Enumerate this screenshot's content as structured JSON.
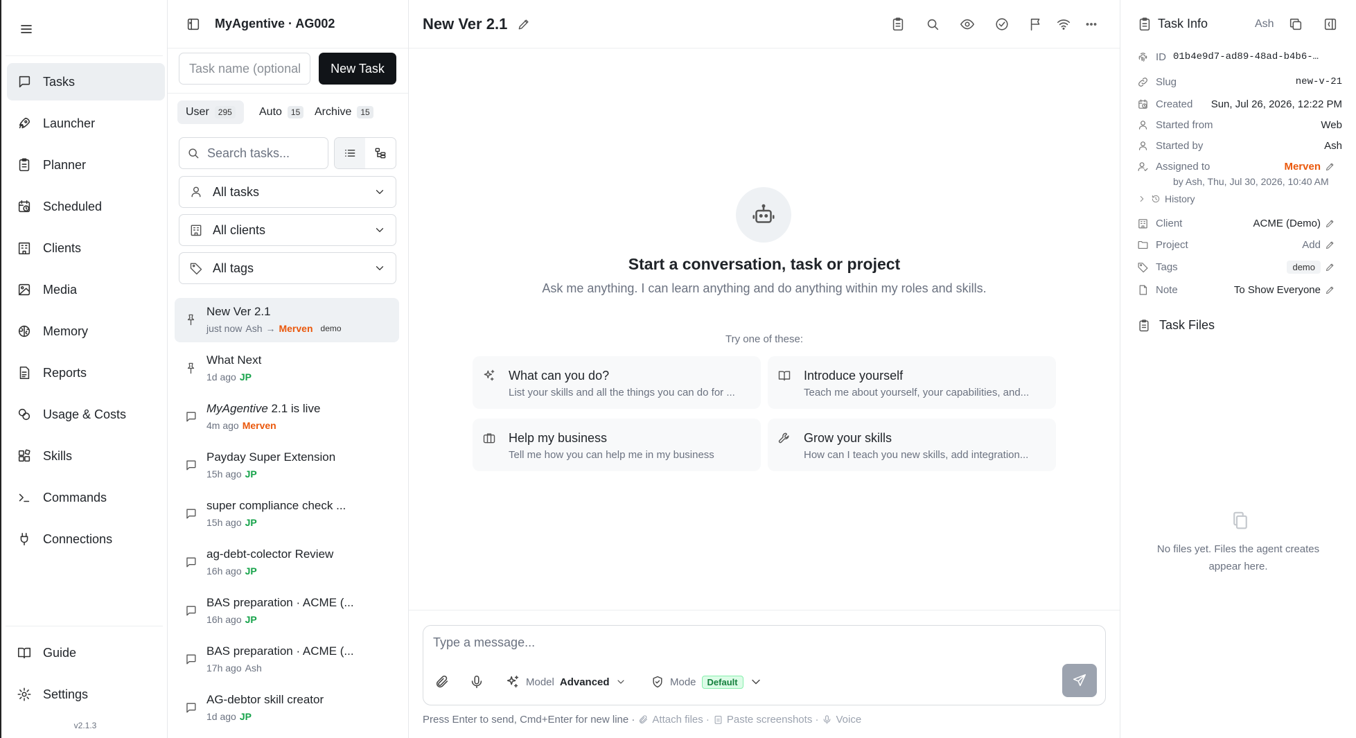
{
  "app": {
    "version": "v2.1.3"
  },
  "nav": {
    "items": [
      {
        "label": "Tasks",
        "icon": "chat-square-icon"
      },
      {
        "label": "Launcher",
        "icon": "rocket-icon"
      },
      {
        "label": "Planner",
        "icon": "clipboard-icon"
      },
      {
        "label": "Scheduled",
        "icon": "calendar-clock-icon"
      },
      {
        "label": "Clients",
        "icon": "building-icon"
      },
      {
        "label": "Media",
        "icon": "image-icon"
      },
      {
        "label": "Memory",
        "icon": "brain-icon"
      },
      {
        "label": "Reports",
        "icon": "report-icon"
      },
      {
        "label": "Usage & Costs",
        "icon": "coins-icon"
      },
      {
        "label": "Skills",
        "icon": "blocks-icon"
      },
      {
        "label": "Commands",
        "icon": "terminal-icon"
      },
      {
        "label": "Connections",
        "icon": "plug-icon"
      }
    ],
    "bottom": [
      {
        "label": "Guide",
        "icon": "book-icon"
      },
      {
        "label": "Settings",
        "icon": "gear-icon"
      }
    ]
  },
  "tasklist": {
    "title": "MyAgentive · AG002",
    "task_name_placeholder": "Task name (optional)",
    "new_task_label": "New Task",
    "tabs": [
      {
        "label": "User",
        "count": "295"
      },
      {
        "label": "Auto",
        "count": "15"
      },
      {
        "label": "Archive",
        "count": "15"
      }
    ],
    "search_placeholder": "Search tasks...",
    "filters": {
      "tasks": "All tasks",
      "clients": "All clients",
      "tags": "All tags"
    },
    "items": [
      {
        "title": "New Ver 2.1",
        "time": "just now",
        "by": "Ash",
        "assignee": "Merven",
        "tag": "demo",
        "pinned": true
      },
      {
        "title": "What Next",
        "time": "1d ago",
        "by": "JP",
        "pinned": true
      },
      {
        "title_em": "MyAgentive",
        "title": " 2.1 is live",
        "time": "4m ago",
        "by": "Merven"
      },
      {
        "title": "Payday Super Extension",
        "time": "15h ago",
        "by": "JP"
      },
      {
        "title": "super compliance check ...",
        "time": "15h ago",
        "by": "JP"
      },
      {
        "title": "ag-debt-colector Review",
        "time": "16h ago",
        "by": "JP"
      },
      {
        "title": "BAS preparation · ACME (...",
        "time": "16h ago",
        "by": "JP"
      },
      {
        "title": "BAS preparation · ACME (...",
        "time": "17h ago",
        "by": "Ash"
      },
      {
        "title": "AG-debtor skill creator",
        "time": "1d ago",
        "by": "JP"
      }
    ]
  },
  "main": {
    "title": "New Ver 2.1",
    "hero_title": "Start a conversation, task or project",
    "hero_subtitle": "Ask me anything. I can learn anything and do anything within my roles and skills.",
    "try_label": "Try one of these:",
    "suggestions": [
      {
        "title": "What can you do?",
        "desc": "List your skills and all the things you can do for ...",
        "icon": "sparkles-icon"
      },
      {
        "title": "Introduce yourself",
        "desc": "Teach me about yourself, your capabilities, and...",
        "icon": "book-open-icon"
      },
      {
        "title": "Help my business",
        "desc": "Tell me how you can help me in my business",
        "icon": "briefcase-icon"
      },
      {
        "title": "Grow your skills",
        "desc": "How can I teach you new skills, add integration...",
        "icon": "wrench-icon"
      }
    ],
    "composer": {
      "placeholder": "Type a message...",
      "model_label": "Model",
      "model_value": "Advanced",
      "mode_label": "Mode",
      "mode_value": "Default"
    },
    "hint": {
      "send": "Press Enter to send, Cmd+Enter for new line ·",
      "attach": "Attach files ·",
      "paste": "Paste screenshots ·",
      "voice": "Voice"
    }
  },
  "task_info": {
    "title": "Task Info",
    "user": "Ash",
    "id_label": "ID",
    "id_value": "01b4e9d7-ad89-48ad-b4b6-…",
    "slug_label": "Slug",
    "slug_value": "new-v-21",
    "created_label": "Created",
    "created_value": "Sun, Jul 26, 2026, 12:22 PM",
    "started_from_label": "Started from",
    "started_from_value": "Web",
    "started_by_label": "Started by",
    "started_by_value": "Ash",
    "assigned_label": "Assigned to",
    "assigned_value": "Merven",
    "assigned_by": "by Ash, Thu, Jul 30, 2026, 10:40 AM",
    "history_label": "History",
    "client_label": "Client",
    "client_value": "ACME (Demo)",
    "project_label": "Project",
    "project_value": "Add",
    "tags_label": "Tags",
    "tags_value": "demo",
    "note_label": "Note",
    "note_value": "To Show Everyone",
    "files_title": "Task Files",
    "files_empty": "No files yet. Files the agent creates appear here."
  }
}
